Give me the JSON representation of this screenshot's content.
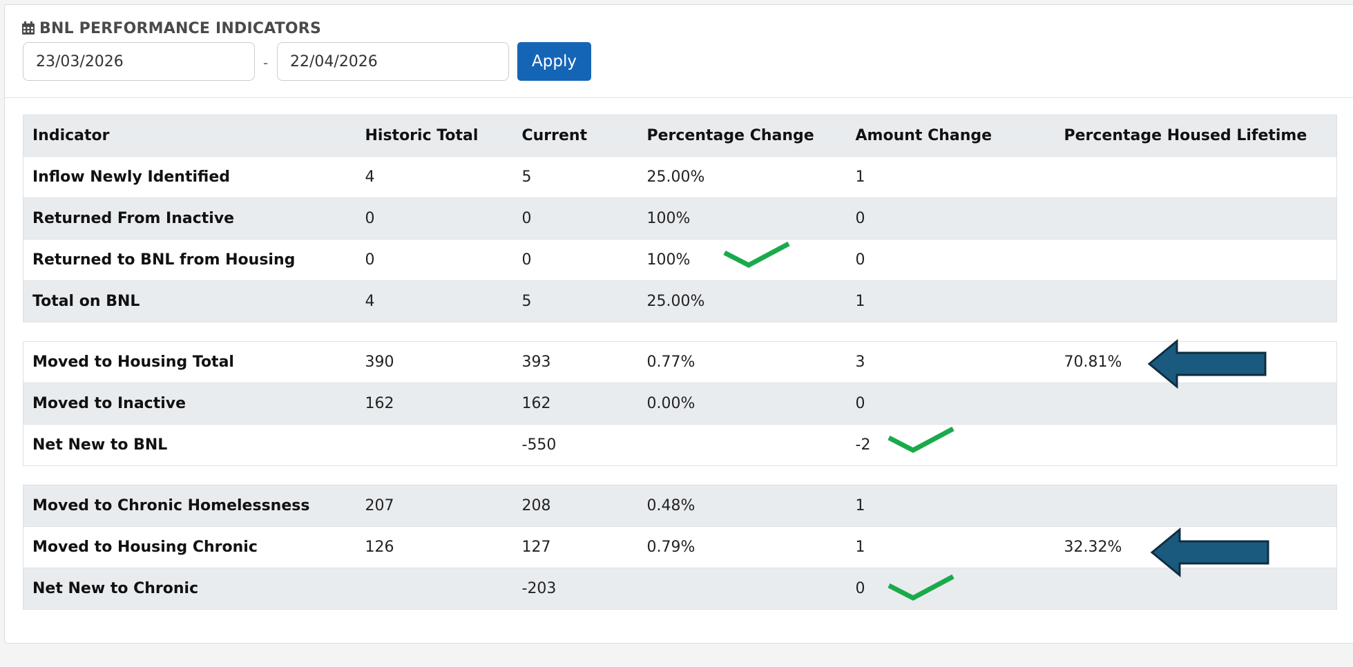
{
  "header": {
    "title": "BNL PERFORMANCE INDICATORS",
    "title_icon": "calendar-icon",
    "start_date": "23/03/2026",
    "date_separator": "-",
    "end_date": "22/04/2026",
    "apply_label": "Apply"
  },
  "columns": [
    "Indicator",
    "Historic Total",
    "Current",
    "Percentage Change",
    "Amount Change",
    "Percentage Housed Lifetime"
  ],
  "section1": [
    {
      "indicator": "Inflow Newly Identified",
      "historic": "4",
      "current": "5",
      "pct": "25.00%",
      "amount": "1",
      "housed": ""
    },
    {
      "indicator": "Returned From Inactive",
      "historic": "0",
      "current": "0",
      "pct": "100%",
      "amount": "0",
      "housed": ""
    },
    {
      "indicator": "Returned to BNL from Housing",
      "historic": "0",
      "current": "0",
      "pct": "100%",
      "amount": "0",
      "housed": ""
    },
    {
      "indicator": "Total on BNL",
      "historic": "4",
      "current": "5",
      "pct": "25.00%",
      "amount": "1",
      "housed": ""
    }
  ],
  "section2": [
    {
      "indicator": "Moved to Housing Total",
      "historic": "390",
      "current": "393",
      "pct": "0.77%",
      "amount": "3",
      "housed": "70.81%"
    },
    {
      "indicator": "Moved to Inactive",
      "historic": "162",
      "current": "162",
      "pct": "0.00%",
      "amount": "0",
      "housed": ""
    },
    {
      "indicator": "Net New to BNL",
      "historic": "",
      "current": "-550",
      "pct": "",
      "amount": "-2",
      "housed": ""
    }
  ],
  "section3": [
    {
      "indicator": "Moved to Chronic Homelessness",
      "historic": "207",
      "current": "208",
      "pct": "0.48%",
      "amount": "1",
      "housed": ""
    },
    {
      "indicator": "Moved to Housing Chronic",
      "historic": "126",
      "current": "127",
      "pct": "0.79%",
      "amount": "1",
      "housed": "32.32%"
    },
    {
      "indicator": "Net New to Chronic",
      "historic": "",
      "current": "-203",
      "pct": "",
      "amount": "0",
      "housed": ""
    }
  ],
  "annotations": {
    "checkmark_color": "#1aaa4b",
    "arrow_color": "#1a5a7e",
    "checkmarks": [
      "checkmark-icon",
      "checkmark-icon",
      "checkmark-icon"
    ],
    "arrows": [
      "arrow-left-icon",
      "arrow-left-icon"
    ]
  }
}
